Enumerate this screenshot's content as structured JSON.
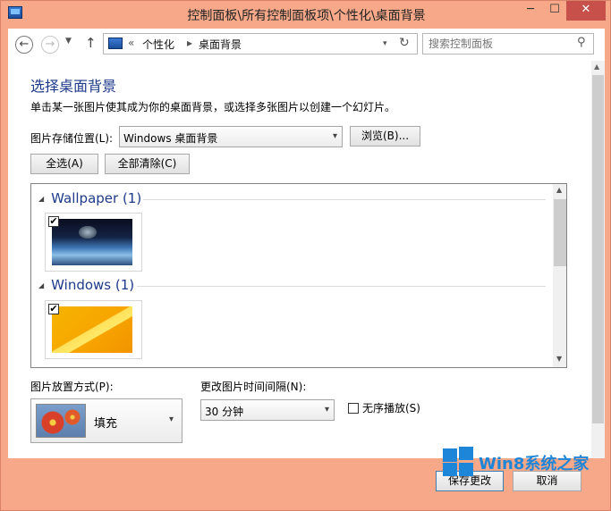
{
  "window": {
    "title": "控制面板\\所有控制面板项\\个性化\\桌面背景",
    "min_glyph": "─",
    "max_glyph": "☐",
    "close_glyph": "✕"
  },
  "nav": {
    "back_glyph": "←",
    "forward_glyph": "→",
    "recent_glyph": "▼",
    "up_glyph": "↑"
  },
  "address": {
    "sep_prefix": "«",
    "crumb1": "个性化",
    "sep": "▸",
    "crumb2": "桌面背景",
    "dropdown_glyph": "▾",
    "refresh_glyph": "↻"
  },
  "search": {
    "placeholder": "搜索控制面板",
    "icon_glyph": "⚲"
  },
  "page": {
    "heading": "选择桌面背景",
    "description": "单击某一张图片使其成为你的桌面背景，或选择多张图片以创建一个幻灯片。",
    "location_label": "图片存储位置(L):",
    "location_value": "Windows 桌面背景",
    "browse_label": "浏览(B)...",
    "select_all_label": "全选(A)",
    "clear_all_label": "全部清除(C)"
  },
  "groups": [
    {
      "name": "Wallpaper (1)",
      "checked": "✔"
    },
    {
      "name": "Windows (1)",
      "checked": "✔"
    }
  ],
  "options": {
    "position_label": "图片放置方式(P):",
    "position_value": "填充",
    "interval_label": "更改图片时间间隔(N):",
    "interval_value": "30 分钟",
    "shuffle_label": "无序播放(S)",
    "arrow_glyph": "▾"
  },
  "footer": {
    "save_label": "保存更改",
    "cancel_label": "取消"
  },
  "watermark": {
    "text": "Win8系统之家"
  },
  "colors": {
    "titlebar": "#f6a889",
    "heading": "#1e3a8a",
    "close_button": "#c7504a",
    "watermark": "#1d86d9"
  }
}
